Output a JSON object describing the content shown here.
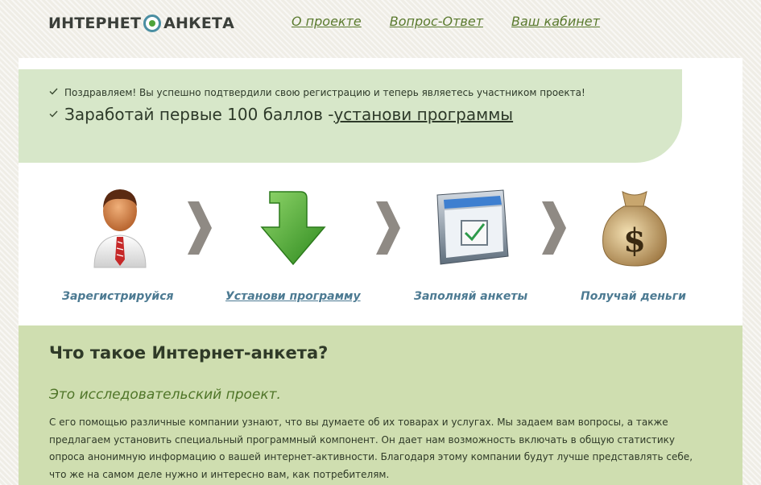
{
  "logo": {
    "part1": "ИНТЕРНЕТ",
    "part2": "АНКЕТА"
  },
  "nav": [
    "О проекте",
    "Вопрос-Ответ",
    "Ваш кабинет"
  ],
  "banner": {
    "line1": "Поздравляем! Вы успешно подтвердили свою регистрацию и теперь являетесь участником проекта!",
    "line2_prefix": "Заработай первые 100 баллов -",
    "line2_link": "установи программы"
  },
  "steps": [
    {
      "label": "Зарегистрируйся",
      "icon": "user-icon"
    },
    {
      "label": "Установи программу",
      "icon": "download-arrow-icon"
    },
    {
      "label": "Заполняй анкеты",
      "icon": "checkbox-window-icon"
    },
    {
      "label": "Получай деньги",
      "icon": "money-bag-icon"
    }
  ],
  "info": {
    "title": "Что такое Интернет-анкета?",
    "subtitle": "Это исследовательский проект.",
    "text": "С его помощью различные компании узнают, что вы думаете об их товарах и услугах. Мы задаем вам вопросы, а также предлагаем установить специальный программный компонент. Он дает нам возможность включать в общую статистику опроса анонимную информацию о вашей интернет-активности. Благодаря этому компании будут лучше представлять себе, что же на самом деле нужно и интересно вам, как потребителям."
  },
  "colors": {
    "banner_bg": "#d7e7c9",
    "info_bg": "#cfdeb0",
    "link": "#5a7a2e",
    "step_label": "#4c7a92"
  }
}
